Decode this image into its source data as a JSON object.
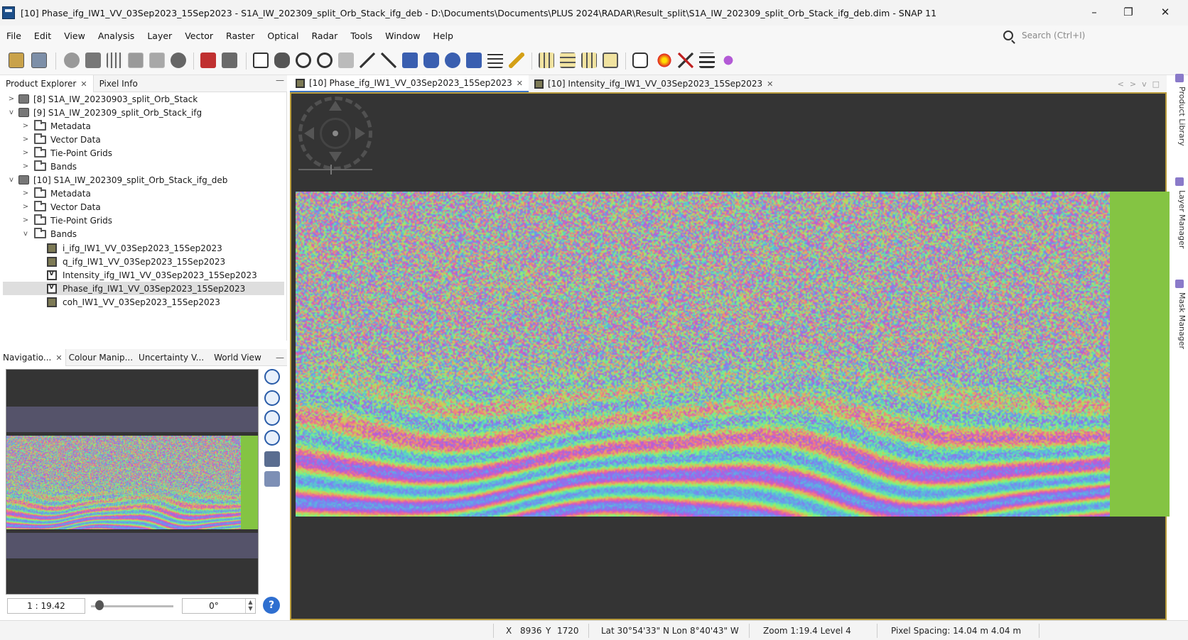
{
  "window": {
    "title": "[10] Phase_ifg_IW1_VV_03Sep2023_15Sep2023 - S1A_IW_202309_split_Orb_Stack_ifg_deb - D:\\Documents\\Documents\\PLUS 2024\\RADAR\\Result_split\\S1A_IW_202309_split_Orb_Stack_ifg_deb.dim - SNAP 11",
    "minimize": "–",
    "restore": "❐",
    "close": "✕"
  },
  "menu": [
    "File",
    "Edit",
    "View",
    "Analysis",
    "Layer",
    "Vector",
    "Raster",
    "Optical",
    "Radar",
    "Tools",
    "Window",
    "Help"
  ],
  "search": {
    "placeholder": "Search (Ctrl+I)"
  },
  "left_top_tabs": [
    {
      "label": "Product Explorer",
      "closable": true
    },
    {
      "label": "Pixel Info",
      "closable": false
    }
  ],
  "tree": [
    {
      "label": "[8] S1A_IW_20230903_split_Orb_Stack",
      "type": "product",
      "expanded": false
    },
    {
      "label": "[9] S1A_IW_202309_split_Orb_Stack_ifg",
      "type": "product",
      "expanded": true
    },
    {
      "label": "Metadata",
      "type": "folder"
    },
    {
      "label": "Vector Data",
      "type": "folder"
    },
    {
      "label": "Tie-Point Grids",
      "type": "folder"
    },
    {
      "label": "Bands",
      "type": "folder"
    },
    {
      "label": "[10] S1A_IW_202309_split_Orb_Stack_ifg_deb",
      "type": "product",
      "expanded": true
    },
    {
      "label": "Metadata",
      "type": "folder"
    },
    {
      "label": "Vector Data",
      "type": "folder"
    },
    {
      "label": "Tie-Point Grids",
      "type": "folder"
    },
    {
      "label": "Bands",
      "type": "folder",
      "expanded": true
    },
    {
      "label": "i_ifg_IW1_VV_03Sep2023_15Sep2023",
      "type": "band"
    },
    {
      "label": "q_ifg_IW1_VV_03Sep2023_15Sep2023",
      "type": "band"
    },
    {
      "label": "Intensity_ifg_IW1_VV_03Sep2023_15Sep2023",
      "type": "virtual-band"
    },
    {
      "label": "Phase_ifg_IW1_VV_03Sep2023_15Sep2023",
      "type": "virtual-band",
      "selected": true
    },
    {
      "label": "coh_IW1_VV_03Sep2023_15Sep2023",
      "type": "band"
    }
  ],
  "left_bottom_tabs": [
    "Navigatio...",
    "Colour Manip...",
    "Uncertainty V...",
    "World View"
  ],
  "navigation": {
    "scale": "1 : 19.42",
    "rotation": "0°",
    "slider_fraction": 0.1,
    "buttons": [
      "zoom-in-icon",
      "zoom-out-icon",
      "zoom-pixel-icon",
      "zoom-all-icon",
      "sync-views-icon",
      "sync-cursor-icon"
    ]
  },
  "editor_tabs": [
    {
      "label": "[10] Phase_ifg_IW1_VV_03Sep2023_15Sep2023",
      "active": true
    },
    {
      "label": "[10] Intensity_ifg_IW1_VV_03Sep2023_15Sep2023",
      "active": false
    }
  ],
  "right_tabs": [
    "Product Library",
    "Layer Manager",
    "Mask Manager"
  ],
  "status": {
    "x_label": "X",
    "x": "8936",
    "y_label": "Y",
    "y": "1720",
    "latlon": "Lat 30°54'33\" N  Lon 8°40'43\" W",
    "zoom": "Zoom 1:19.4  Level 4",
    "pixel_spacing": "Pixel Spacing: 14.04 m  4.04 m"
  },
  "colors": {
    "accent": "#3b73c4",
    "frame": "#b79a3a",
    "nodata_green": "#84c443",
    "background_dark": "#343434"
  }
}
